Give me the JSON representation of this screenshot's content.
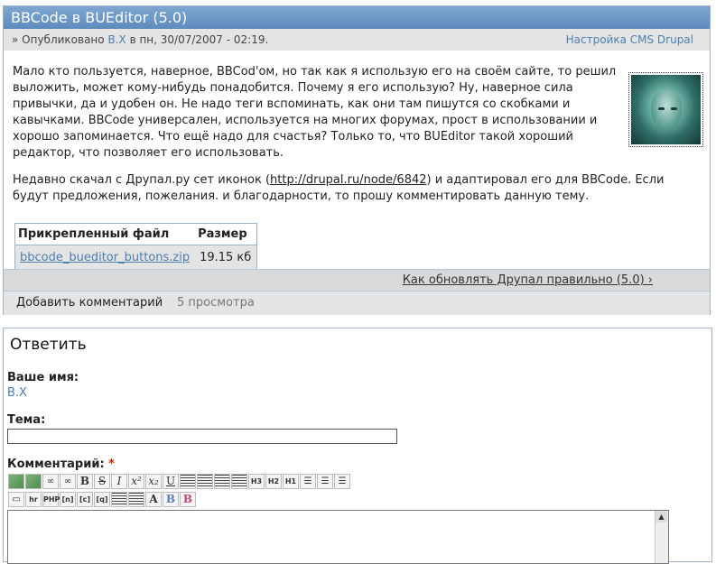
{
  "node": {
    "title": "BBCode в BUEditor (5.0)",
    "submitted_prefix": "» Опубликовано",
    "author": "B.X",
    "submitted_middle": "в пн, 30/07/2007 - 02:19.",
    "category": "Настройка CMS Drupal",
    "paragraph1": "Мало кто пользуется, наверное, BBCod'ом, но так как я использую его на своём сайте, то решил выложить, может кому-нибудь понадобится. Почему я его использую? Ну, наверное сила привычки, да и удобен он. Не надо теги вспоминать, как они там пишутся со скобками и кавычками. BBCode универсален, используется на многих форумах, прост в использовании и хорошо запоминается. Что ещё надо для счастья? Только то, что BUEditor такой хороший редактор, что позволяет его использовать.",
    "paragraph2_start": "Недавно скачал с Друпал.ру сет иконок (",
    "paragraph2_link": "http://drupal.ru/node/6842",
    "paragraph2_end": ") и адаптировал его для BBCode. Если будут предложения, пожелания. и благодарности, то прошу комментировать данную тему.",
    "attachments": {
      "col_file": "Прикрепленный файл",
      "col_size": "Размер",
      "file": "bbcode_bueditor_buttons.zip",
      "size": "19.15 кб"
    },
    "next_link": "Как обновлять Друпал правильно (5.0) ›",
    "add_comment": "Добавить комментарий",
    "reads": "5 просмотра"
  },
  "reply": {
    "heading": "Ответить",
    "name_label": "Ваше имя:",
    "name_value": "B.X",
    "subject_label": "Тема:",
    "subject_value": "",
    "comment_label": "Комментарий:",
    "required_mark": "*",
    "toolbar_row1": [
      {
        "name": "insert-image-icon",
        "glyph": "",
        "cls": "img"
      },
      {
        "name": "insert-picture-icon",
        "glyph": "",
        "cls": "img"
      },
      {
        "name": "insert-link-icon",
        "glyph": "∞",
        "cls": ""
      },
      {
        "name": "insert-url-icon",
        "glyph": "∞",
        "cls": ""
      },
      {
        "name": "bold-icon",
        "glyph": "B",
        "cls": "bold"
      },
      {
        "name": "strikethrough-icon",
        "glyph": "S",
        "cls": "s"
      },
      {
        "name": "italic-icon",
        "glyph": "I",
        "cls": "it"
      },
      {
        "name": "superscript-icon",
        "glyph": "x²",
        "cls": "it"
      },
      {
        "name": "subscript-icon",
        "glyph": "x₂",
        "cls": "it"
      },
      {
        "name": "underline-icon",
        "glyph": "U",
        "cls": "u"
      },
      {
        "name": "align-left-icon",
        "glyph": "",
        "cls": "lines"
      },
      {
        "name": "align-center-icon",
        "glyph": "",
        "cls": "lines"
      },
      {
        "name": "align-right-icon",
        "glyph": "",
        "cls": "lines"
      },
      {
        "name": "align-justify-icon",
        "glyph": "",
        "cls": "lines"
      },
      {
        "name": "heading3-icon",
        "glyph": "H3",
        "cls": "small"
      },
      {
        "name": "heading2-icon",
        "glyph": "H2",
        "cls": "small"
      },
      {
        "name": "heading1-icon",
        "glyph": "H1",
        "cls": "small"
      },
      {
        "name": "unordered-list-icon",
        "glyph": "☰",
        "cls": ""
      },
      {
        "name": "ordered-list-icon",
        "glyph": "☰",
        "cls": ""
      },
      {
        "name": "list-item-icon",
        "glyph": "☰",
        "cls": ""
      }
    ],
    "toolbar_row2": [
      {
        "name": "quote-block-icon",
        "glyph": "▭",
        "cls": ""
      },
      {
        "name": "horizontal-rule-icon",
        "glyph": "hr",
        "cls": "small"
      },
      {
        "name": "php-code-icon",
        "glyph": "PHP",
        "cls": "small"
      },
      {
        "name": "noparse-icon",
        "glyph": "[n]",
        "cls": "small"
      },
      {
        "name": "code-icon",
        "glyph": "[c]",
        "cls": "small"
      },
      {
        "name": "quote-icon",
        "glyph": "[q]",
        "cls": "small"
      },
      {
        "name": "color-icon",
        "glyph": "",
        "cls": "lines"
      },
      {
        "name": "size-icon",
        "glyph": "",
        "cls": "lines"
      },
      {
        "name": "font-icon",
        "glyph": "A",
        "cls": "bold"
      },
      {
        "name": "preview-b-icon",
        "glyph": "B",
        "cls": "blue"
      },
      {
        "name": "help-b-icon",
        "glyph": "B",
        "cls": "pink"
      }
    ],
    "comment_value": ""
  }
}
